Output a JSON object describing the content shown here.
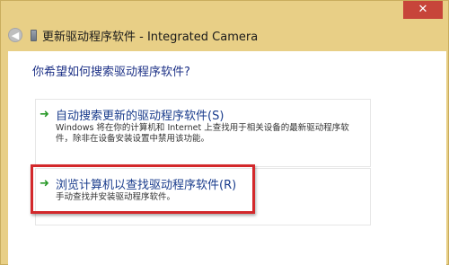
{
  "window": {
    "title": "更新驱动程序软件 - Integrated Camera",
    "close_label": "✕"
  },
  "back_button_glyph": "◀",
  "main": {
    "question": "你希望如何搜索驱动程序软件?",
    "options": [
      {
        "title": "自动搜索更新的驱动程序软件(S)",
        "description": "Windows 将在你的计算机和 Internet 上查找用于相关设备的最新驱动程序软件，除非在设备安装设置中禁用该功能。",
        "arrow_glyph": "➜"
      },
      {
        "title": "浏览计算机以查找驱动程序软件(R)",
        "description": "手动查找并安装驱动程序软件。",
        "arrow_glyph": "➜"
      }
    ]
  },
  "colors": {
    "frame": "#e8cf86",
    "close_button": "#c7453a",
    "link_text": "#1a3c8c",
    "question_text": "#1e3287",
    "arrow": "#2a9a2a",
    "highlight": "#d3282b"
  },
  "icons": {
    "back": "back-arrow-icon",
    "device": "device-icon",
    "option_arrow": "green-arrow-icon"
  }
}
